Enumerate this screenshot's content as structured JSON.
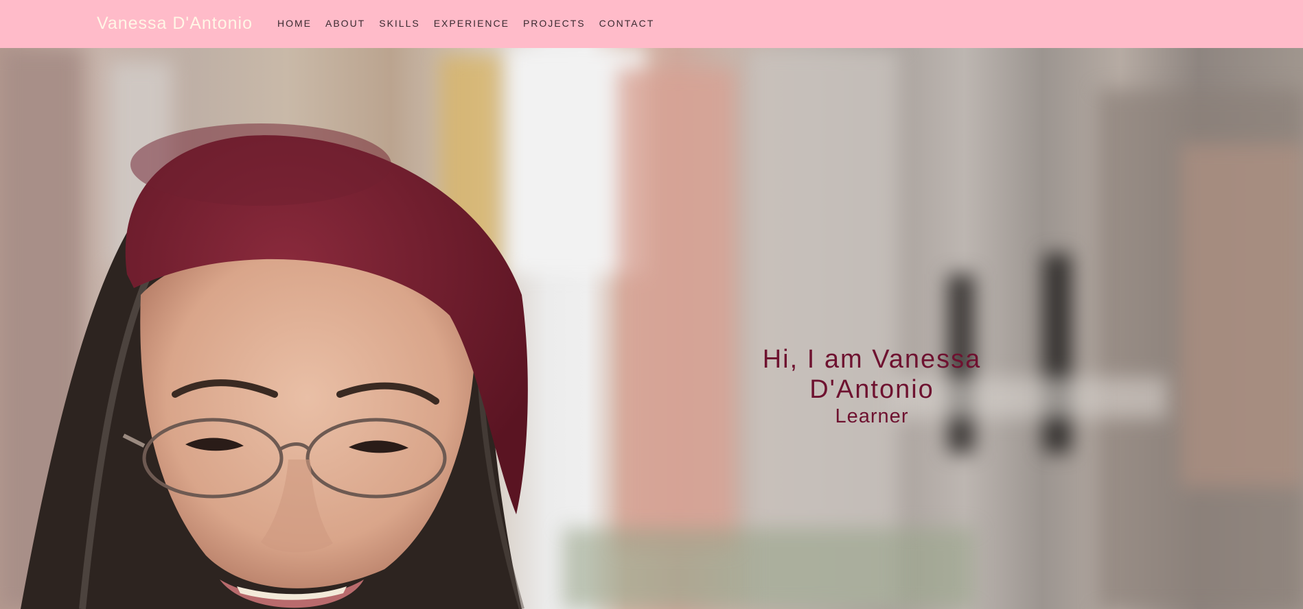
{
  "nav": {
    "brand": "Vanessa D'Antonio",
    "links": [
      {
        "label": "HOME"
      },
      {
        "label": "ABOUT"
      },
      {
        "label": "SKILLS"
      },
      {
        "label": "EXPERIENCE"
      },
      {
        "label": "PROJECTS"
      },
      {
        "label": "CONTACT"
      }
    ]
  },
  "hero": {
    "greeting": "Hi, I am Vanessa D'Antonio",
    "tagline": "Learner"
  },
  "colors": {
    "nav_background": "#ffbbc9",
    "brand_text": "#fff6e6",
    "nav_link_text": "#3a2a30",
    "hero_text": "#6e1230"
  },
  "icons": [
    "hero-portrait-photo"
  ]
}
